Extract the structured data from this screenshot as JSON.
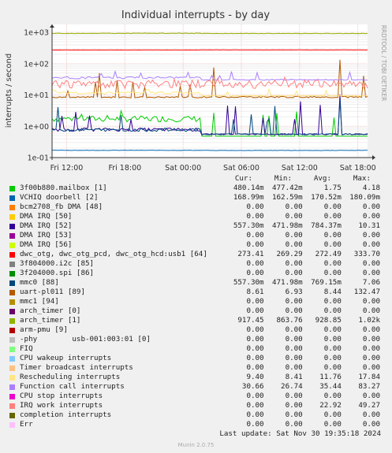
{
  "chart_data": {
    "type": "line",
    "title": "Individual interrupts - by day",
    "ylabel": "interrupts / second",
    "side_label": "RRDTOOL / TOBI OETIKER",
    "y_scale": "log",
    "ylim": [
      0.1,
      1000
    ],
    "y_ticks": [
      "1e+03",
      "1e+02",
      "1e+01",
      "1e+00",
      "1e-01"
    ],
    "x_ticks": [
      "Fri 12:00",
      "Fri 18:00",
      "Sat 00:00",
      "Sat 06:00",
      "Sat 12:00",
      "Sat 18:00"
    ],
    "grid": true,
    "columns": [
      "Cur:",
      "Min:",
      "Avg:",
      "Max:"
    ],
    "series": [
      {
        "name": "3f00b880.mailbox [1]",
        "color": "#00cc00",
        "cur": "480.14m",
        "min": "477.42m",
        "avg": "1.75",
        "max": "4.18"
      },
      {
        "name": "VCHIQ doorbell [2]",
        "color": "#0066b3",
        "cur": "168.99m",
        "min": "162.59m",
        "avg": "170.52m",
        "max": "180.09m"
      },
      {
        "name": "bcm2708_fb DMA [48]",
        "color": "#ff8000",
        "cur": "0.00",
        "min": "0.00",
        "avg": "0.00",
        "max": "0.00"
      },
      {
        "name": "DMA IRQ [50]",
        "color": "#ffcc00",
        "cur": "0.00",
        "min": "0.00",
        "avg": "0.00",
        "max": "0.00"
      },
      {
        "name": "DMA IRQ [52]",
        "color": "#330099",
        "cur": "557.30m",
        "min": "471.98m",
        "avg": "784.37m",
        "max": "10.31"
      },
      {
        "name": "DMA IRQ [53]",
        "color": "#990099",
        "cur": "0.00",
        "min": "0.00",
        "avg": "0.00",
        "max": "0.00"
      },
      {
        "name": "DMA IRQ [56]",
        "color": "#ccff00",
        "cur": "0.00",
        "min": "0.00",
        "avg": "0.00",
        "max": "0.00"
      },
      {
        "name": "dwc_otg, dwc_otg_pcd, dwc_otg_hcd:usb1 [64]",
        "color": "#ff0000",
        "cur": "273.41",
        "min": "269.29",
        "avg": "272.49",
        "max": "333.70"
      },
      {
        "name": "3f804000.i2c [85]",
        "color": "#808080",
        "cur": "0.00",
        "min": "0.00",
        "avg": "0.00",
        "max": "0.00"
      },
      {
        "name": "3f204000.spi [86]",
        "color": "#008f00",
        "cur": "0.00",
        "min": "0.00",
        "avg": "0.00",
        "max": "0.00"
      },
      {
        "name": "mmc0 [88]",
        "color": "#00487d",
        "cur": "557.30m",
        "min": "471.98m",
        "avg": "769.15m",
        "max": "7.06"
      },
      {
        "name": "uart-pl011 [89]",
        "color": "#b35a00",
        "cur": "8.61",
        "min": "6.93",
        "avg": "8.44",
        "max": "132.47"
      },
      {
        "name": "mmc1 [94]",
        "color": "#b38f00",
        "cur": "0.00",
        "min": "0.00",
        "avg": "0.00",
        "max": "0.00"
      },
      {
        "name": "arch_timer [0]",
        "color": "#6b006b",
        "cur": "0.00",
        "min": "0.00",
        "avg": "0.00",
        "max": "0.00"
      },
      {
        "name": "arch_timer [1]",
        "color": "#8fb300",
        "cur": "917.45",
        "min": "863.76",
        "avg": "928.85",
        "max": "1.02k"
      },
      {
        "name": "arm-pmu [9]",
        "color": "#b30000",
        "cur": "0.00",
        "min": "0.00",
        "avg": "0.00",
        "max": "0.00"
      },
      {
        "name": "-phy        usb-001:003:01 [0]",
        "color": "#bebebe",
        "cur": "0.00",
        "min": "0.00",
        "avg": "0.00",
        "max": "0.00"
      },
      {
        "name": "FIQ",
        "color": "#80ff80",
        "cur": "0.00",
        "min": "0.00",
        "avg": "0.00",
        "max": "0.00"
      },
      {
        "name": "CPU wakeup interrupts",
        "color": "#80c9ff",
        "cur": "0.00",
        "min": "0.00",
        "avg": "0.00",
        "max": "0.00"
      },
      {
        "name": "Timer broadcast interrupts",
        "color": "#ffc080",
        "cur": "0.00",
        "min": "0.00",
        "avg": "0.00",
        "max": "0.00"
      },
      {
        "name": "Rescheduling interrupts",
        "color": "#ffe680",
        "cur": "9.40",
        "min": "8.41",
        "avg": "11.76",
        "max": "17.84"
      },
      {
        "name": "Function call interrupts",
        "color": "#aa80ff",
        "cur": "30.66",
        "min": "26.74",
        "avg": "35.44",
        "max": "83.27"
      },
      {
        "name": "CPU stop interrupts",
        "color": "#ee00cc",
        "cur": "0.00",
        "min": "0.00",
        "avg": "0.00",
        "max": "0.00"
      },
      {
        "name": "IRQ work interrupts",
        "color": "#ff8080",
        "cur": "0.00",
        "min": "0.00",
        "avg": "22.92",
        "max": "49.27"
      },
      {
        "name": "completion interrupts",
        "color": "#666600",
        "cur": "0.00",
        "min": "0.00",
        "avg": "0.00",
        "max": "0.00"
      },
      {
        "name": "Err",
        "color": "#ffbfff",
        "cur": "0.00",
        "min": "0.00",
        "avg": "0.00",
        "max": "0.00"
      }
    ],
    "last_update": "Last update: Sat Nov 30 19:35:18 2024",
    "footer": "Munin 2.0.75"
  }
}
